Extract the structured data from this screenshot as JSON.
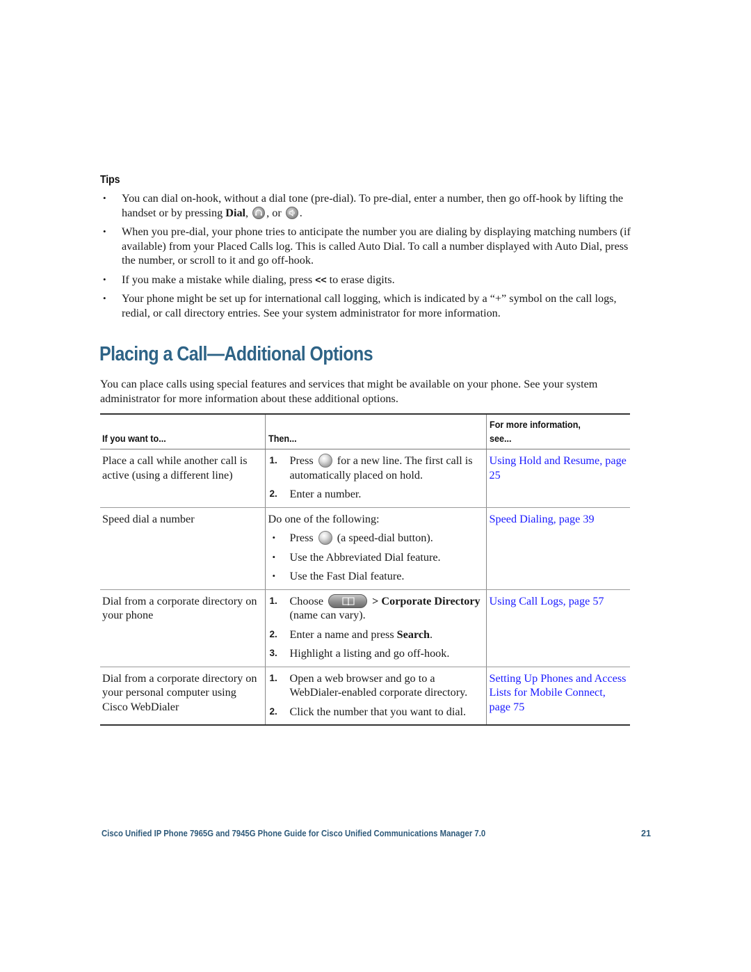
{
  "tips": {
    "heading": "Tips",
    "items": [
      {
        "parts": [
          "You can dial on-hook, without a dial tone (pre-dial). To pre-dial, enter a number, then go off-hook by lifting the handset or by pressing ",
          "Dial",
          ", ",
          ", or ",
          "."
        ],
        "icons": [
          "headset-button-icon",
          "speaker-button-icon"
        ]
      },
      {
        "text": "When you pre-dial, your phone tries to anticipate the number you are dialing by displaying matching numbers (if available) from your Placed Calls log. This is called Auto Dial. To call a number displayed with Auto Dial, press the number, or scroll to it and go off-hook."
      },
      {
        "parts": [
          "If you make a mistake while dialing, press ",
          "<<",
          " to erase digits."
        ]
      },
      {
        "text": "Your phone might be set up for international call logging, which is indicated by a “+” symbol on the call logs, redial, or call directory entries. See your system administrator for more information."
      }
    ]
  },
  "section": {
    "title": "Placing a Call—Additional Options",
    "intro": "You can place calls using special features and services that might be available on your phone. See your system administrator for more information about these additional options."
  },
  "table": {
    "headers": [
      "If you want to...",
      "Then...",
      "For more information, see..."
    ],
    "rows": [
      {
        "want": "Place a call while another call is active (using a different line)",
        "steps": [
          {
            "num": "1.",
            "pre": "Press ",
            "icon": "line-button-icon",
            "post": " for a new line. The first call is automatically placed on hold."
          },
          {
            "num": "2.",
            "text": "Enter a number."
          }
        ],
        "see": "Using Hold and Resume, page 25"
      },
      {
        "want": "Speed dial a number",
        "intro": "Do one of the following:",
        "bullets": [
          {
            "pre": "Press ",
            "icon": "speed-dial-button-icon",
            "post": " (a speed-dial button)."
          },
          {
            "text": "Use the Abbreviated Dial feature."
          },
          {
            "text": "Use the Fast Dial feature."
          }
        ],
        "see": "Speed Dialing, page 39"
      },
      {
        "want": "Dial from a corporate directory on your phone",
        "steps": [
          {
            "num": "1.",
            "pre": "Choose ",
            "icon": "directories-button-icon",
            "bold1": " > Corporate Directory",
            "post": " (name can vary)."
          },
          {
            "num": "2.",
            "pre": "Enter a name and press ",
            "bold1": "Search",
            "post": "."
          },
          {
            "num": "3.",
            "text": "Highlight a listing and go off-hook."
          }
        ],
        "see": "Using Call Logs, page 57"
      },
      {
        "want": "Dial from a corporate directory on your personal computer using Cisco WebDialer",
        "steps": [
          {
            "num": "1.",
            "text": "Open a web browser and go to a WebDialer-enabled corporate directory."
          },
          {
            "num": "2.",
            "text": "Click the number that you want to dial."
          }
        ],
        "see": "Setting Up Phones and Access Lists for Mobile Connect, page 75"
      }
    ]
  },
  "footer": {
    "title": "Cisco Unified IP Phone 7965G and 7945G Phone Guide for Cisco Unified Communications Manager 7.0",
    "page_number": "21"
  },
  "colors": {
    "heading": "#2e6386",
    "link": "#1a1aff",
    "footer": "#2e5a7a"
  }
}
